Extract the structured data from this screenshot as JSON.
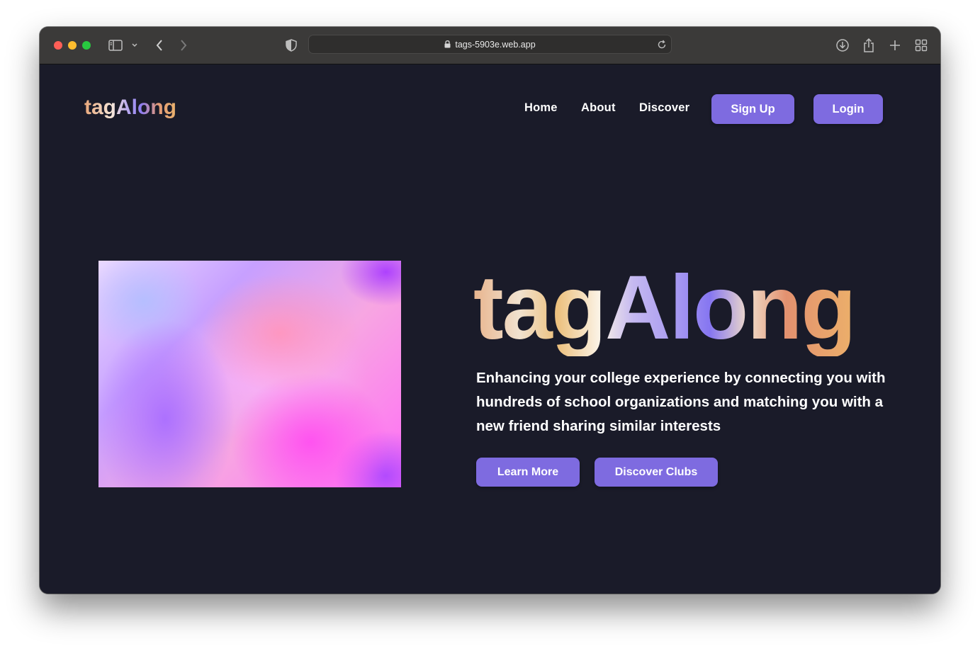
{
  "browser": {
    "url": "tags-5903e.web.app"
  },
  "nav": {
    "logo_text": "tagAlong",
    "links": [
      "Home",
      "About",
      "Discover"
    ],
    "signup_label": "Sign Up",
    "login_label": "Login"
  },
  "hero": {
    "logo_text": "tagAlong",
    "tagline": "Enhancing your college experience by connecting you with hundreds of school organizations and matching you with a new friend sharing similar interests",
    "learn_more_label": "Learn More",
    "discover_clubs_label": "Discover Clubs"
  },
  "colors": {
    "page_background": "#1a1b29",
    "accent": "#7e6be0"
  },
  "icons": [
    "sidebar-icon",
    "chevron-down-icon",
    "back-icon",
    "forward-icon",
    "shield-icon",
    "lock-icon",
    "reload-icon",
    "download-icon",
    "share-icon",
    "new-tab-icon",
    "tab-overview-icon",
    "smiley-icon"
  ]
}
